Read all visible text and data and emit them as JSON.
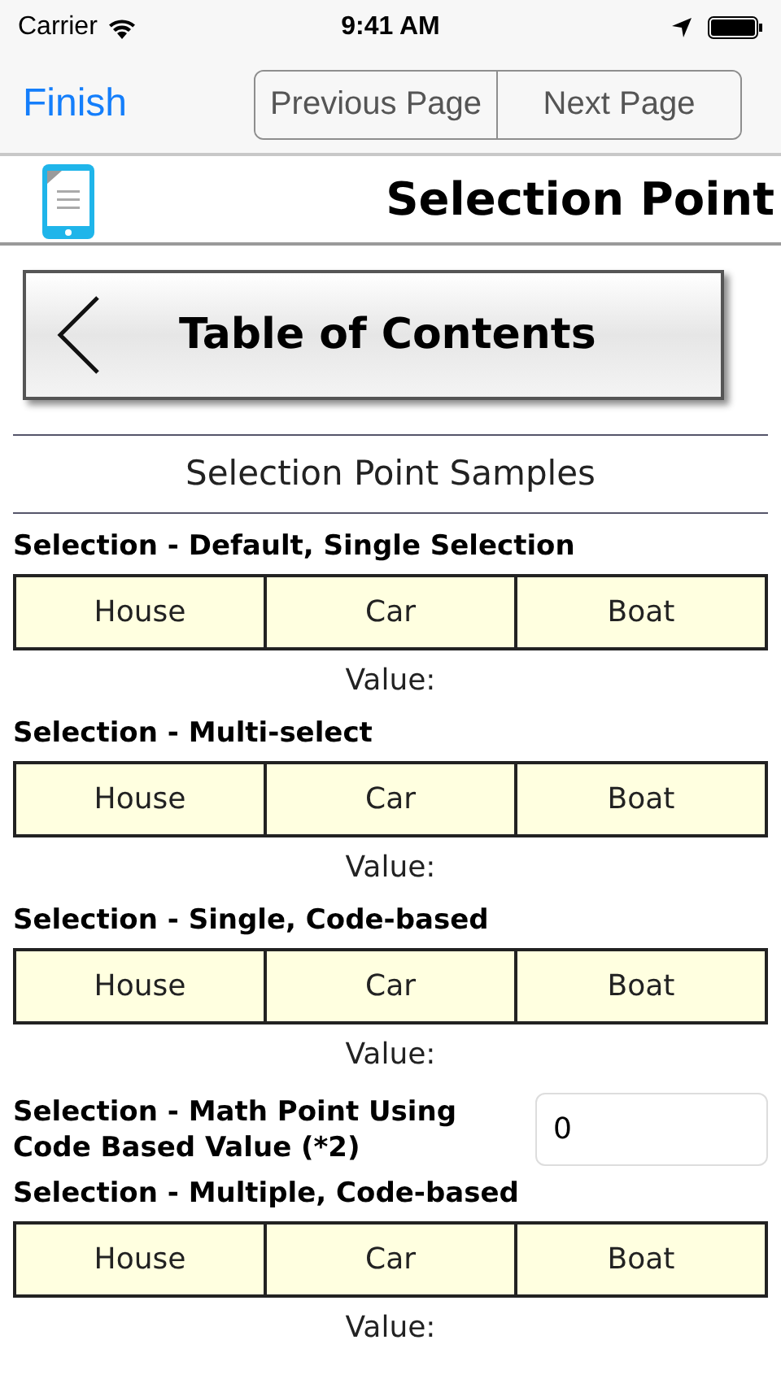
{
  "status_bar": {
    "carrier": "Carrier",
    "time": "9:41 AM"
  },
  "nav": {
    "finish": "Finish",
    "segments": [
      {
        "label": "Previous Page",
        "selected": false
      },
      {
        "label": "Next Page",
        "selected": false
      }
    ]
  },
  "header": {
    "title": "Selection Point"
  },
  "toc_button": "Table of Contents",
  "section_title": "Selection Point Samples",
  "sections": [
    {
      "kind": "selection",
      "label": "Selection - Default, Single Selection",
      "options": [
        {
          "label": "House",
          "selected": false
        },
        {
          "label": "Car",
          "selected": false
        },
        {
          "label": "Boat",
          "selected": false
        }
      ],
      "value_label": "Value:"
    },
    {
      "kind": "selection",
      "label": "Selection - Multi-select",
      "options": [
        {
          "label": "House",
          "selected": false
        },
        {
          "label": "Car",
          "selected": false
        },
        {
          "label": "Boat",
          "selected": false
        }
      ],
      "value_label": "Value:"
    },
    {
      "kind": "selection",
      "label": "Selection - Single, Code-based",
      "options": [
        {
          "label": "House",
          "selected": false
        },
        {
          "label": "Car",
          "selected": false
        },
        {
          "label": "Boat",
          "selected": false
        }
      ],
      "value_label": "Value:"
    },
    {
      "kind": "math",
      "label": "Selection - Math Point Using Code Based Value (*2)",
      "value": "0"
    },
    {
      "kind": "selection",
      "label": "Selection - Multiple, Code-based",
      "options": [
        {
          "label": "House",
          "selected": false
        },
        {
          "label": "Car",
          "selected": false
        },
        {
          "label": "Boat",
          "selected": false
        }
      ],
      "value_label": "Value:"
    }
  ]
}
